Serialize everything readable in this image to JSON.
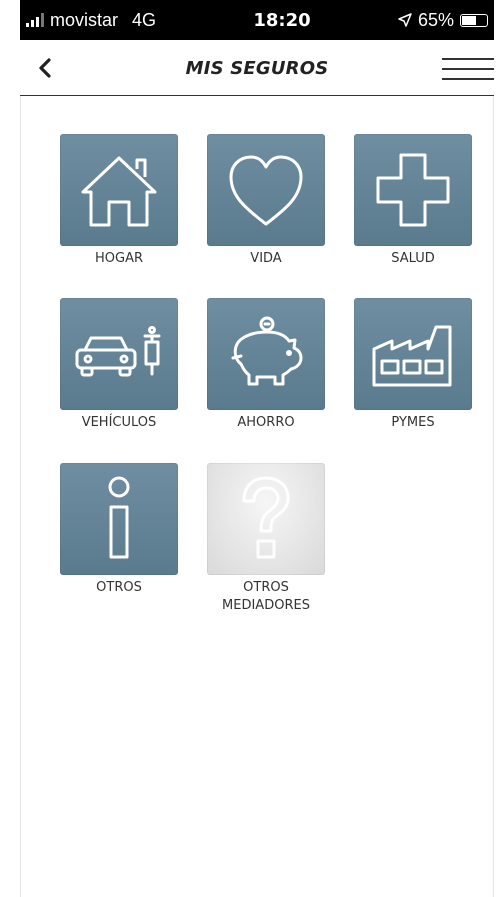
{
  "status_bar": {
    "carrier": "movistar",
    "network": "4G",
    "time": "18:20",
    "battery_percent": "65%",
    "battery_level": 0.65
  },
  "nav": {
    "title": "MIS SEGUROS",
    "back_icon": "chevron-left-icon",
    "menu_icon": "hamburger-menu-icon"
  },
  "tiles": [
    {
      "label": "HOGAR",
      "icon": "house-icon"
    },
    {
      "label": "VIDA",
      "icon": "heart-icon"
    },
    {
      "label": "SALUD",
      "icon": "cross-icon"
    },
    {
      "label": "VEHÍCULOS",
      "icon": "car-scooter-icon"
    },
    {
      "label": "AHORRO",
      "icon": "piggy-bank-icon"
    },
    {
      "label": "PYMES",
      "icon": "factory-icon"
    },
    {
      "label": "OTROS",
      "icon": "info-icon"
    },
    {
      "label": "OTROS MEDIADORES",
      "icon": "question-icon"
    }
  ],
  "colors": {
    "tile_blue": "#5f7f93",
    "tile_disabled": "#e3e3e3",
    "status_bar_bg": "#000000"
  }
}
